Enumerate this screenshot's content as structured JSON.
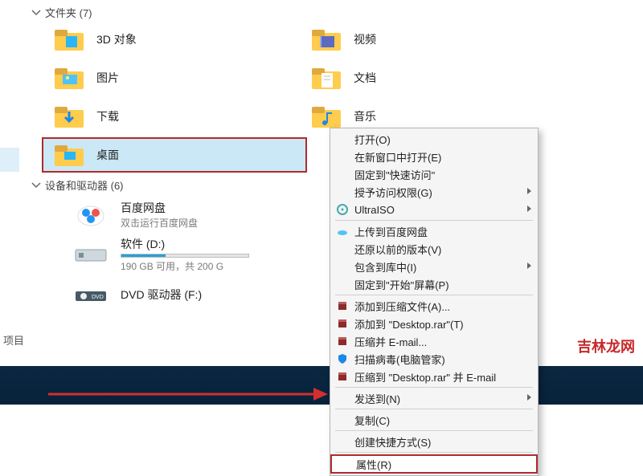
{
  "sections": {
    "folders_header": "文件夹 (7)",
    "drives_header": "设备和驱动器 (6)"
  },
  "folders": [
    {
      "label": "3D 对象"
    },
    {
      "label": "视频"
    },
    {
      "label": "图片"
    },
    {
      "label": "文档"
    },
    {
      "label": "下载"
    },
    {
      "label": "音乐"
    },
    {
      "label": "桌面"
    }
  ],
  "drives": [
    {
      "label": "百度网盘",
      "sub": "双击运行百度网盘"
    },
    {
      "label": "软件 (D:)",
      "sub": "190 GB 可用，共 200 G"
    },
    {
      "label": "DVD 驱动器 (F:)",
      "sub": ""
    }
  ],
  "context_menu": [
    {
      "label": "打开(O)",
      "icon": ""
    },
    {
      "label": "在新窗口中打开(E)",
      "icon": ""
    },
    {
      "label": "固定到\"快速访问\"",
      "icon": ""
    },
    {
      "label": "授予访问权限(G)",
      "icon": "",
      "submenu": true
    },
    {
      "label": "UltraISO",
      "icon": "disc",
      "submenu": true
    },
    {
      "label": "上传到百度网盘",
      "icon": "cloud"
    },
    {
      "label": "还原以前的版本(V)",
      "icon": ""
    },
    {
      "label": "包含到库中(I)",
      "icon": "",
      "submenu": true
    },
    {
      "label": "固定到\"开始\"屏幕(P)",
      "icon": ""
    },
    {
      "label": "添加到压缩文件(A)...",
      "icon": "archive"
    },
    {
      "label": "添加到 \"Desktop.rar\"(T)",
      "icon": "archive"
    },
    {
      "label": "压缩并 E-mail...",
      "icon": "archive"
    },
    {
      "label": "扫描病毒(电脑管家)",
      "icon": "shield"
    },
    {
      "label": "压缩到 \"Desktop.rar\" 并 E-mail",
      "icon": "archive"
    },
    {
      "label": "发送到(N)",
      "icon": "",
      "submenu": true
    },
    {
      "label": "复制(C)",
      "icon": ""
    },
    {
      "label": "创建快捷方式(S)",
      "icon": ""
    },
    {
      "label": "属性(R)",
      "icon": "",
      "highlight": true
    }
  ],
  "bottom_label": "项目",
  "watermark": "吉林龙网"
}
